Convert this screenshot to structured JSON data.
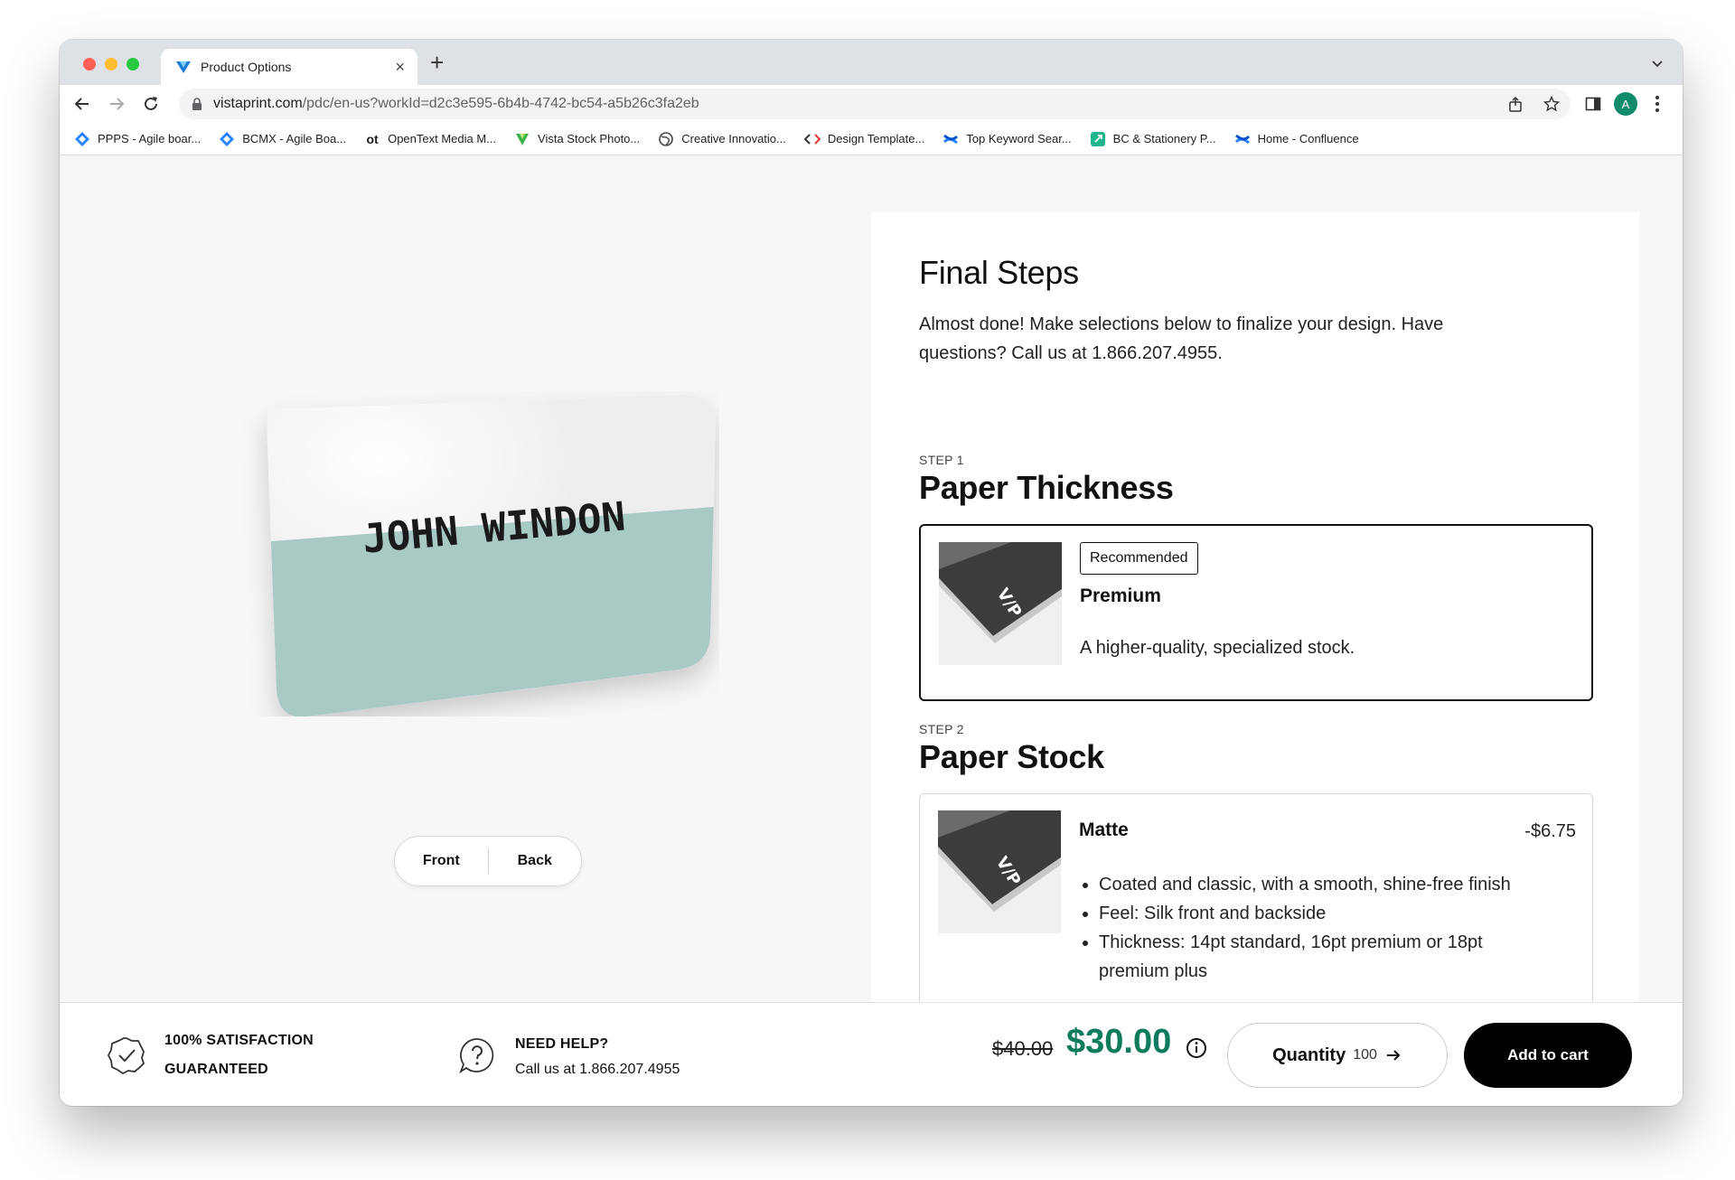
{
  "browser": {
    "tab_title": "Product Options",
    "tab_close": "×",
    "new_tab": "+",
    "url_domain": "vistaprint.com",
    "url_path": "/pdc/en-us?workId=d2c3e595-6b4b-4742-bc54-a5b26c3fa2eb",
    "avatar_letter": "A",
    "bookmarks": [
      {
        "label": "PPPS - Agile boar...",
        "icon": "jira-icon"
      },
      {
        "label": "BCMX - Agile Boa...",
        "icon": "jira-icon"
      },
      {
        "label": "OpenText Media M...",
        "icon": "opentext-icon",
        "glyph": "ot"
      },
      {
        "label": "Vista Stock Photo...",
        "icon": "vista-icon"
      },
      {
        "label": "Creative Innovatio...",
        "icon": "globe-icon"
      },
      {
        "label": "Design Template...",
        "icon": "code-icon"
      },
      {
        "label": "Top Keyword Sear...",
        "icon": "confluence-icon"
      },
      {
        "label": "BC & Stationery P...",
        "icon": "link-icon"
      },
      {
        "label": "Home - Confluence",
        "icon": "confluence-icon"
      }
    ]
  },
  "preview": {
    "card_name": "JOHN WINDON",
    "front_label": "Front",
    "back_label": "Back"
  },
  "panel": {
    "title": "Final Steps",
    "description": "Almost done! Make selections below to finalize your design. Have questions? Call us at 1.866.207.4955.",
    "step1": {
      "label": "STEP 1",
      "title": "Paper Thickness",
      "option": {
        "badge": "Recommended",
        "name": "Premium",
        "description": "A higher-quality, specialized stock."
      }
    },
    "step2": {
      "label": "STEP 2",
      "title": "Paper Stock",
      "option": {
        "name": "Matte",
        "price": "-$6.75",
        "bullets": [
          "Coated and classic, with a smooth, shine-free finish",
          "Feel: Silk front and backside",
          "Thickness: 14pt standard, 16pt premium or 18pt premium plus"
        ]
      }
    },
    "thumb_logo": "V/P"
  },
  "bottom": {
    "guarantee_line1": "100% SATISFACTION",
    "guarantee_line2": "GUARANTEED",
    "help_title": "NEED HELP?",
    "help_text": "Call us at 1.866.207.4955",
    "old_price": "$40.00",
    "new_price": "$30.00",
    "quantity_label": "Quantity",
    "quantity_value": "100",
    "add_to_cart": "Add to cart"
  },
  "colors": {
    "price_green": "#0e7b5e",
    "card_teal": "#a9c9c4",
    "avatar": "#0f8a6b"
  }
}
